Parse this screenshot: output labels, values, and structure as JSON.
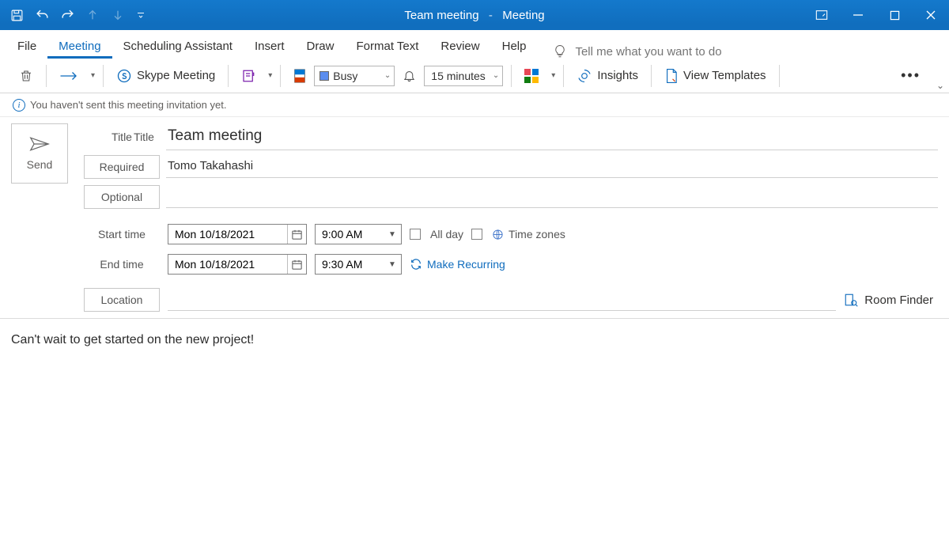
{
  "window": {
    "title_doc": "Team meeting",
    "title_context": "Meeting"
  },
  "qat": {
    "save": "Save",
    "undo": "Undo",
    "redo": "Redo",
    "prev": "Previous Item",
    "next": "Next Item"
  },
  "tabs": {
    "file": "File",
    "meeting": "Meeting",
    "scheduling": "Scheduling Assistant",
    "insert": "Insert",
    "draw": "Draw",
    "format": "Format Text",
    "review": "Review",
    "help": "Help"
  },
  "tellme": {
    "placeholder": "Tell me what you want to do"
  },
  "ribbon": {
    "skype": "Skype Meeting",
    "busy": "Busy",
    "reminder": "15 minutes",
    "insights": "Insights",
    "templates": "View Templates"
  },
  "info": {
    "msg": "You haven't sent this meeting invitation yet."
  },
  "send": {
    "label": "Send"
  },
  "form": {
    "title_label": "Title",
    "title_value": "Team meeting",
    "required_label": "Required",
    "required_value": "Tomo Takahashi",
    "optional_label": "Optional",
    "optional_value": "",
    "start_label": "Start time",
    "start_date": "Mon 10/18/2021",
    "start_time": "9:00 AM",
    "end_label": "End time",
    "end_date": "Mon 10/18/2021",
    "end_time": "9:30 AM",
    "allday": "All day",
    "timezones": "Time zones",
    "recurring": "Make Recurring",
    "location_label": "Location",
    "location_value": "",
    "room_finder": "Room Finder"
  },
  "body": {
    "text": "Can't wait to get started on the new project!"
  }
}
